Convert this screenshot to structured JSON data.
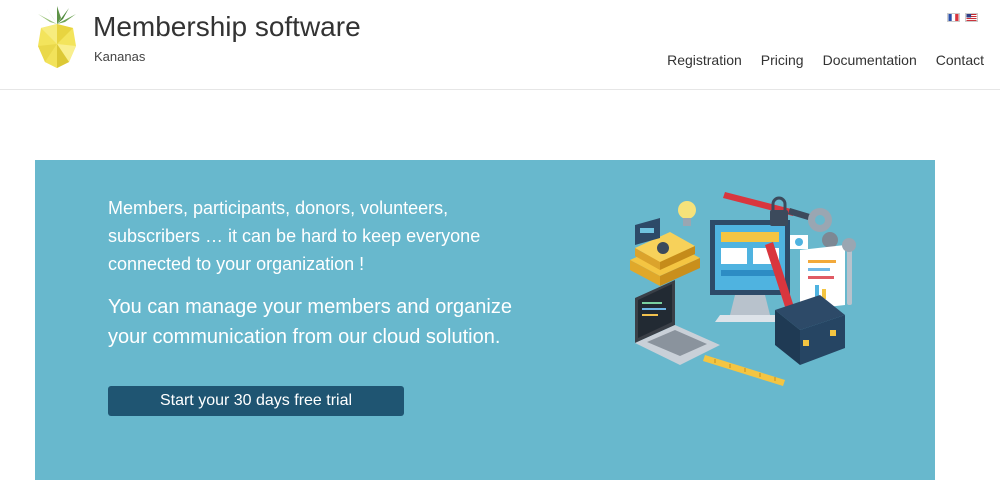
{
  "header": {
    "title": "Membership software",
    "subtitle": "Kananas",
    "languages": [
      "fr",
      "us"
    ]
  },
  "nav": {
    "items": [
      "Registration",
      "Pricing",
      "Documentation",
      "Contact"
    ]
  },
  "hero": {
    "paragraph1": "Members, participants, donors, volunteers, subscribers … it can be hard to keep everyone connected to your organization !",
    "paragraph2": "You can manage your members and organize your communication from our cloud solution.",
    "cta_label": "Start your 30 days free trial",
    "background_color": "#68b8cd",
    "button_color": "#1f5572"
  },
  "icons": [
    "pineapple-logo-icon",
    "flag-fr-icon",
    "flag-us-icon",
    "office-tools-illustration"
  ]
}
